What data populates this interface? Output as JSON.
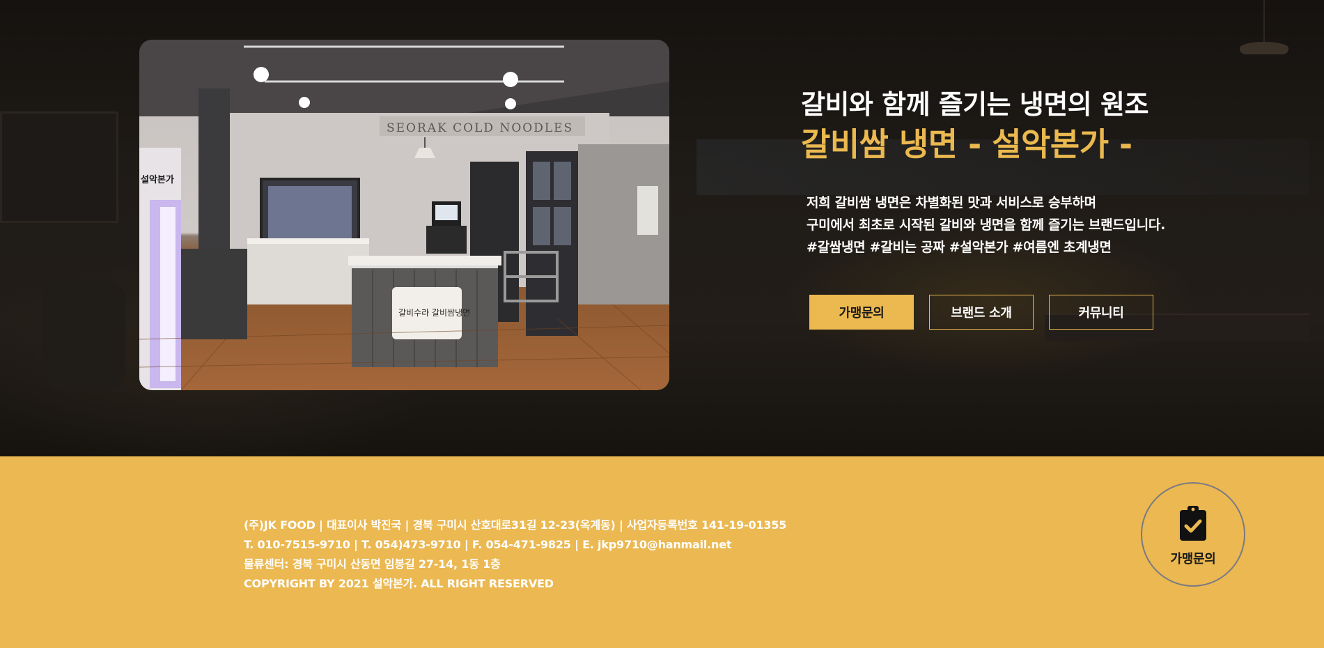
{
  "hero": {
    "subtitle": "갈비와 함께 즐기는 냉면의 원조",
    "title": "갈비쌈 냉면 - 설악본가 -",
    "description_lines": [
      "저희 갈비쌈 냉면은 차별화된 맛과 서비스로 승부하며",
      "구미에서 최초로 시작된 갈비와 냉면을 함께 즐기는 브랜드입니다.",
      "#갈쌈냉면 #갈비는 공짜 #설악본가 #여름엔 초계냉면"
    ],
    "buttons": {
      "franchise": "가맹문의",
      "brand": "브랜드 소개",
      "community": "커뮤니티"
    },
    "photo": {
      "sign_text": "SEORAK COLD NOODLES",
      "panel_text": "갈비수라 갈비쌈냉면",
      "side_text": "설악본가"
    },
    "accent_color": "#ebb94f"
  },
  "footer": {
    "lines": [
      "(주)JK FOOD | 대표이사 박진국 | 경북 구미시 산호대로31길 12-23(옥계동) | 사업자등록번호 141-19-01355",
      "T. 010-7515-9710 | T. 054)473-9710 | F. 054-471-9825 | E. jkp9710@hanmail.net",
      "물류센터: 경북 구미시 산동면 임봉길 27-14, 1동 1층",
      "COPYRIGHT BY 2021 설악본가. ALL RIGHT RESERVED"
    ],
    "fab_label": "가맹문의",
    "fab_icon": "clipboard-check-icon",
    "background_color": "#ebb851"
  }
}
